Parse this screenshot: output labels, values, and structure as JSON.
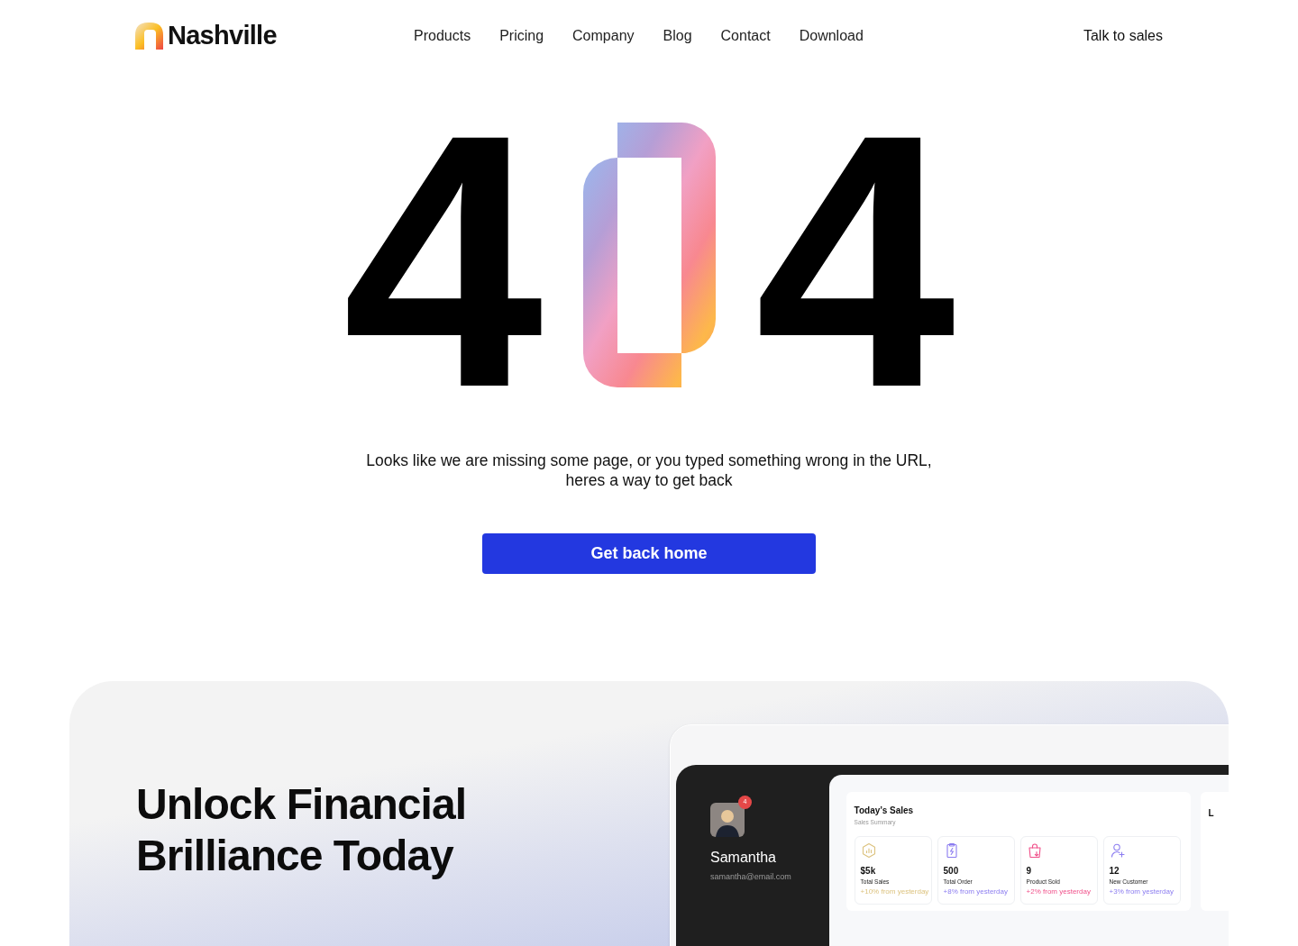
{
  "header": {
    "logo": "Nashville",
    "nav": [
      "Products",
      "Pricing",
      "Company",
      "Blog",
      "Contact",
      "Download"
    ],
    "cta": "Talk to sales"
  },
  "error": {
    "digits": [
      "4",
      "4"
    ],
    "message_lines": [
      "Looks like we are missing some page, or you typed something wrong in the URL,",
      "heres a way to get back"
    ],
    "button": "Get back home"
  },
  "promo": {
    "heading_lines": [
      "Unlock Financial",
      "Brilliance Today"
    ],
    "dashboard": {
      "user": {
        "name": "Samantha",
        "email": "samantha@email.com",
        "notifications": "4"
      },
      "sales": {
        "title": "Today’s Sales",
        "subtitle": "Sales Summary",
        "stats": [
          {
            "kind": "sales",
            "value": "$5k",
            "label": "Total Sales",
            "change": "+10% from yesterday",
            "color": "#dcc27e"
          },
          {
            "kind": "order",
            "value": "500",
            "label": "Total Order",
            "change": "+8% from yesterday",
            "color": "#8b7cf0"
          },
          {
            "kind": "product",
            "value": "9",
            "label": "Product Sold",
            "change": "+2% from yesterday",
            "color": "#f0508a"
          },
          {
            "kind": "customer",
            "value": "12",
            "label": "New Customer",
            "change": "+3% from yesterday",
            "color": "#8b7cf0"
          }
        ]
      },
      "side_card": {
        "title": "L"
      }
    }
  }
}
